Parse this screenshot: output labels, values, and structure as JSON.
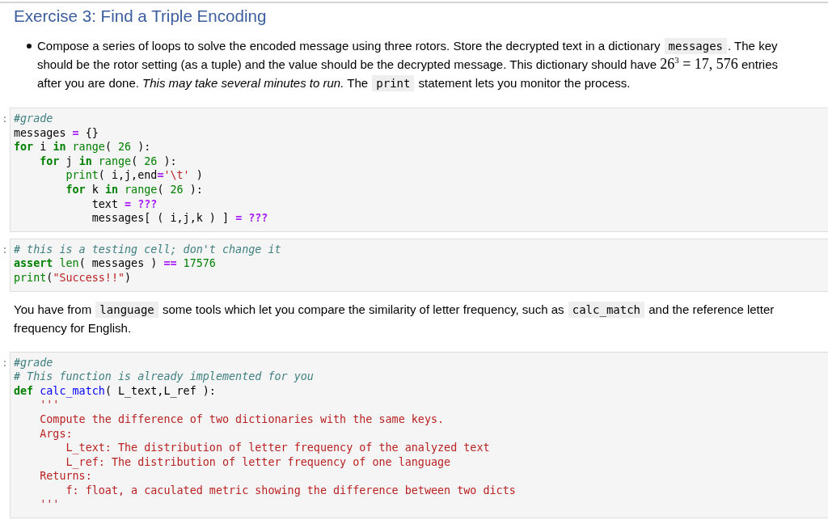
{
  "heading": "Exercise 3: Find a Triple Encoding",
  "bullets": [
    [
      {
        "kind": "text",
        "text": "Compose a series of loops to solve the encoded message using three rotors. Store the decrypted text in a dictionary "
      },
      {
        "kind": "code",
        "text": "messages"
      },
      {
        "kind": "text",
        "text": ". The key should be the rotor setting (as a tuple) and the value should be the decrypted message. This dictionary should have "
      },
      {
        "kind": "math",
        "text": "26$^{3}$ = 17, 576"
      },
      {
        "kind": "text",
        "text": " entries after you are done. *This may take several minutes to run.* The "
      },
      {
        "kind": "code",
        "text": "print"
      },
      {
        "kind": "text",
        "text": " statement lets you monitor the process."
      }
    ]
  ],
  "cells": [
    {
      "kind": "code",
      "prompt": ":",
      "lines": [
        [
          {
            "kind": "comment",
            "text": "#grade"
          }
        ],
        [
          {
            "kind": "plain",
            "text": "messages "
          },
          {
            "kind": "operator",
            "text": "="
          },
          {
            "kind": "plain",
            "text": " {}"
          }
        ],
        [
          {
            "kind": "keyword",
            "text": "for"
          },
          {
            "kind": "plain",
            "text": " i "
          },
          {
            "kind": "keyword",
            "text": "in"
          },
          {
            "kind": "builtin",
            "text": " range"
          },
          {
            "kind": "plain",
            "text": "( "
          },
          {
            "kind": "number",
            "text": "26"
          },
          {
            "kind": "plain",
            "text": " ):"
          }
        ],
        [
          {
            "kind": "keyword",
            "text": "    for"
          },
          {
            "kind": "plain",
            "text": " j "
          },
          {
            "kind": "keyword",
            "text": "in"
          },
          {
            "kind": "builtin",
            "text": " range"
          },
          {
            "kind": "plain",
            "text": "( "
          },
          {
            "kind": "number",
            "text": "26"
          },
          {
            "kind": "plain",
            "text": " ):"
          }
        ],
        [
          {
            "kind": "builtin",
            "text": "        print"
          },
          {
            "kind": "plain",
            "text": "( i,j,end"
          },
          {
            "kind": "operator",
            "text": "="
          },
          {
            "kind": "string",
            "text": "'\\t'"
          },
          {
            "kind": "plain",
            "text": " )"
          }
        ],
        [
          {
            "kind": "keyword",
            "text": "        for"
          },
          {
            "kind": "plain",
            "text": " k "
          },
          {
            "kind": "keyword",
            "text": "in"
          },
          {
            "kind": "builtin",
            "text": " range"
          },
          {
            "kind": "plain",
            "text": "( "
          },
          {
            "kind": "number",
            "text": "26"
          },
          {
            "kind": "plain",
            "text": " ):"
          }
        ],
        [
          {
            "kind": "plain",
            "text": "            text "
          },
          {
            "kind": "operator",
            "text": "="
          },
          {
            "kind": "invalid",
            "text": " ???"
          }
        ],
        [
          {
            "kind": "plain",
            "text": "            messages[ ( i,j,k ) ] "
          },
          {
            "kind": "operator",
            "text": "="
          },
          {
            "kind": "invalid",
            "text": " ???"
          }
        ]
      ]
    },
    {
      "kind": "code",
      "prompt": ":",
      "lines": [
        [
          {
            "kind": "comment",
            "text": "# this is a testing cell; don't change it"
          }
        ],
        [
          {
            "kind": "keyword",
            "text": "assert"
          },
          {
            "kind": "builtin",
            "text": " len"
          },
          {
            "kind": "plain",
            "text": "( messages ) "
          },
          {
            "kind": "operator",
            "text": "=="
          },
          {
            "kind": "number",
            "text": " 17576"
          }
        ],
        [
          {
            "kind": "builtin",
            "text": "print"
          },
          {
            "kind": "plain",
            "text": "("
          },
          {
            "kind": "string",
            "text": "\"Success!!\""
          },
          {
            "kind": "plain",
            "text": ")"
          }
        ]
      ]
    },
    {
      "kind": "text",
      "segments": [
        {
          "kind": "text",
          "text": "You have from "
        },
        {
          "kind": "code",
          "text": "language"
        },
        {
          "kind": "text",
          "text": " some tools which let you compare the similarity of letter frequency, such as "
        },
        {
          "kind": "code",
          "text": "calc_match"
        },
        {
          "kind": "text",
          "text": " and the reference letter frequency for English."
        }
      ]
    },
    {
      "kind": "code",
      "prompt": ":",
      "lines": [
        [
          {
            "kind": "comment",
            "text": "#grade"
          }
        ],
        [
          {
            "kind": "comment",
            "text": "# This function is already implemented for you"
          }
        ],
        [
          {
            "kind": "keyword",
            "text": "def"
          },
          {
            "kind": "function",
            "text": " calc_match"
          },
          {
            "kind": "plain",
            "text": "( L_text,L_ref ):"
          }
        ],
        [
          {
            "kind": "string",
            "text": "    '''"
          }
        ],
        [
          {
            "kind": "string",
            "text": "    Compute the difference of two dictionaries with the same keys."
          }
        ],
        [
          {
            "kind": "string",
            "text": "    Args:"
          }
        ],
        [
          {
            "kind": "string",
            "text": "        L_text: The distribution of letter frequency of the analyzed text"
          }
        ],
        [
          {
            "kind": "string",
            "text": "        L_ref: The distribution of letter frequency of one language"
          }
        ],
        [
          {
            "kind": "string",
            "text": "    Returns:"
          }
        ],
        [
          {
            "kind": "string",
            "text": "        f: float, a caculated metric showing the difference between two dicts"
          }
        ],
        [
          {
            "kind": "string",
            "text": "    '''"
          }
        ]
      ]
    }
  ]
}
